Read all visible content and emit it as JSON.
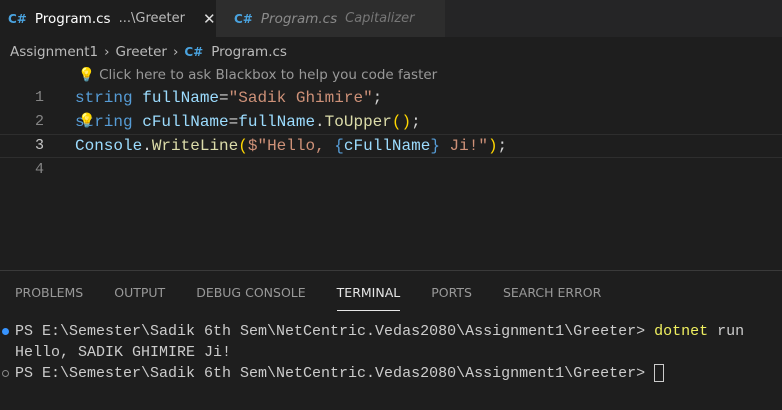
{
  "tabs": [
    {
      "label": "Program.cs",
      "description": "...\\Greeter",
      "close": "✕",
      "icon": "csharp-file-icon"
    },
    {
      "label": "Program.cs",
      "description": "Capitalizer",
      "icon": "csharp-file-icon"
    }
  ],
  "breadcrumb": [
    "Assignment1",
    "Greeter",
    "Program.cs"
  ],
  "breadcrumb_sep": "›",
  "hint": "Click here to ask Blackbox to help you code faster",
  "editor": {
    "line_numbers": [
      "1",
      "2",
      "3",
      "4"
    ],
    "l1": [
      "string",
      " fullName",
      "=",
      "\"Sadik Ghimire\"",
      ";"
    ],
    "l2": [
      "string",
      " cFullName",
      "=",
      "fullName",
      ".",
      "ToUpper",
      "()",
      ";"
    ],
    "l3": [
      "Console",
      ".",
      "WriteLine",
      "(",
      "$\"Hello, ",
      "{",
      "cFullName",
      "}",
      " Ji!\"",
      ")",
      ";"
    ]
  },
  "panel": {
    "tabs": [
      "PROBLEMS",
      "OUTPUT",
      "DEBUG CONSOLE",
      "TERMINAL",
      "PORTS",
      "SEARCH ERROR"
    ],
    "active": "TERMINAL"
  },
  "terminal": {
    "prompt": "PS E:\\Semester\\Sadik 6th Sem\\NetCentric.Vedas2080\\Assignment1\\Greeter> ",
    "cmd": "dotnet",
    "args": " run",
    "output": "Hello, SADIK GHIMIRE Ji!"
  },
  "colors": {
    "accent": "#4aa3df",
    "keyword": "#569cd6",
    "string": "#ce9178"
  }
}
